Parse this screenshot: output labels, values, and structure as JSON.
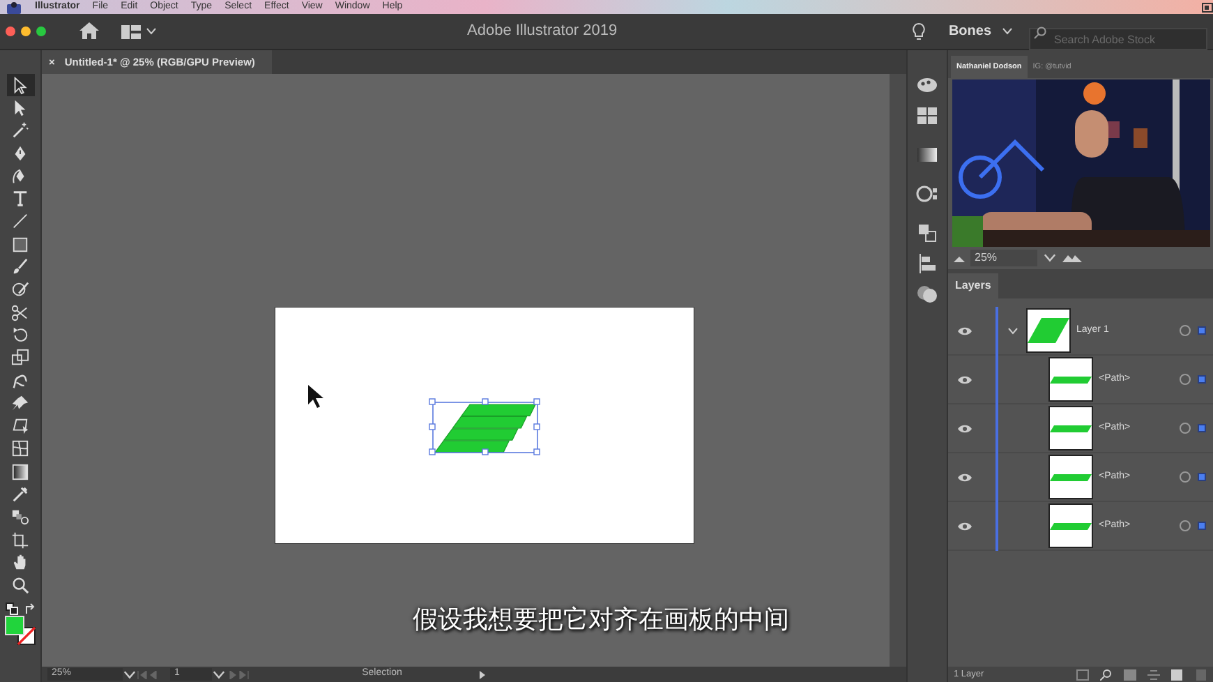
{
  "menu_bar": {
    "items": [
      {
        "label": "Illustrator"
      },
      {
        "label": "File"
      },
      {
        "label": "Edit"
      },
      {
        "label": "Object"
      },
      {
        "label": "Type"
      },
      {
        "label": "Select"
      },
      {
        "label": "Effect"
      },
      {
        "label": "View"
      },
      {
        "label": "Window"
      },
      {
        "label": "Help"
      }
    ]
  },
  "title_bar": {
    "title": "Adobe Illustrator 2019",
    "workspace": "Bones",
    "search": {
      "placeholder": "Search Adobe Stock"
    }
  },
  "document_tab": {
    "close": "×",
    "label": "Untitled-1* @ 25% (RGB/GPU Preview)"
  },
  "tools": [
    {
      "kind": "selection",
      "selected": true
    },
    {
      "kind": "direct",
      "selected": false
    },
    {
      "kind": "wand",
      "selected": false
    },
    {
      "kind": "pen",
      "selected": false
    },
    {
      "kind": "curvature",
      "selected": false
    },
    {
      "kind": "type",
      "selected": false
    },
    {
      "kind": "line",
      "selected": false
    },
    {
      "kind": "rect",
      "selected": false
    },
    {
      "kind": "brush",
      "selected": false
    },
    {
      "kind": "shaper",
      "selected": false
    },
    {
      "kind": "scissors",
      "selected": false
    },
    {
      "kind": "rotate",
      "selected": false
    },
    {
      "kind": "scale",
      "selected": false
    },
    {
      "kind": "warp",
      "selected": false
    },
    {
      "kind": "pin",
      "selected": false
    },
    {
      "kind": "transform",
      "selected": false
    },
    {
      "kind": "mesh",
      "selected": false
    },
    {
      "kind": "gradient",
      "selected": false
    },
    {
      "kind": "eyedropper",
      "selected": false
    },
    {
      "kind": "blend",
      "selected": false
    },
    {
      "kind": "crop",
      "selected": false
    },
    {
      "kind": "hand",
      "selected": false
    },
    {
      "kind": "zoom",
      "selected": false
    }
  ],
  "artwork": {
    "selected": true
  },
  "caption": "假设我想要把它对齐在画板的中间",
  "status_bar": {
    "zoom": "25%",
    "artboard": "1",
    "tool": "Selection"
  },
  "video_panel": {
    "tabs": [
      {
        "label": "Nathaniel Dodson",
        "selected": true
      },
      {
        "label": "IG: @tutvid",
        "selected": false
      }
    ],
    "zoom": "25%"
  },
  "layers": {
    "title": "Layers",
    "rows": [
      {
        "name": "Layer 1",
        "visible": true,
        "expanded": true,
        "children": [
          {
            "name": "<Path>",
            "visible": true
          },
          {
            "name": "<Path>",
            "visible": true
          },
          {
            "name": "<Path>",
            "visible": true
          },
          {
            "name": "<Path>",
            "visible": true
          }
        ]
      }
    ],
    "footer": "1 Layer"
  }
}
